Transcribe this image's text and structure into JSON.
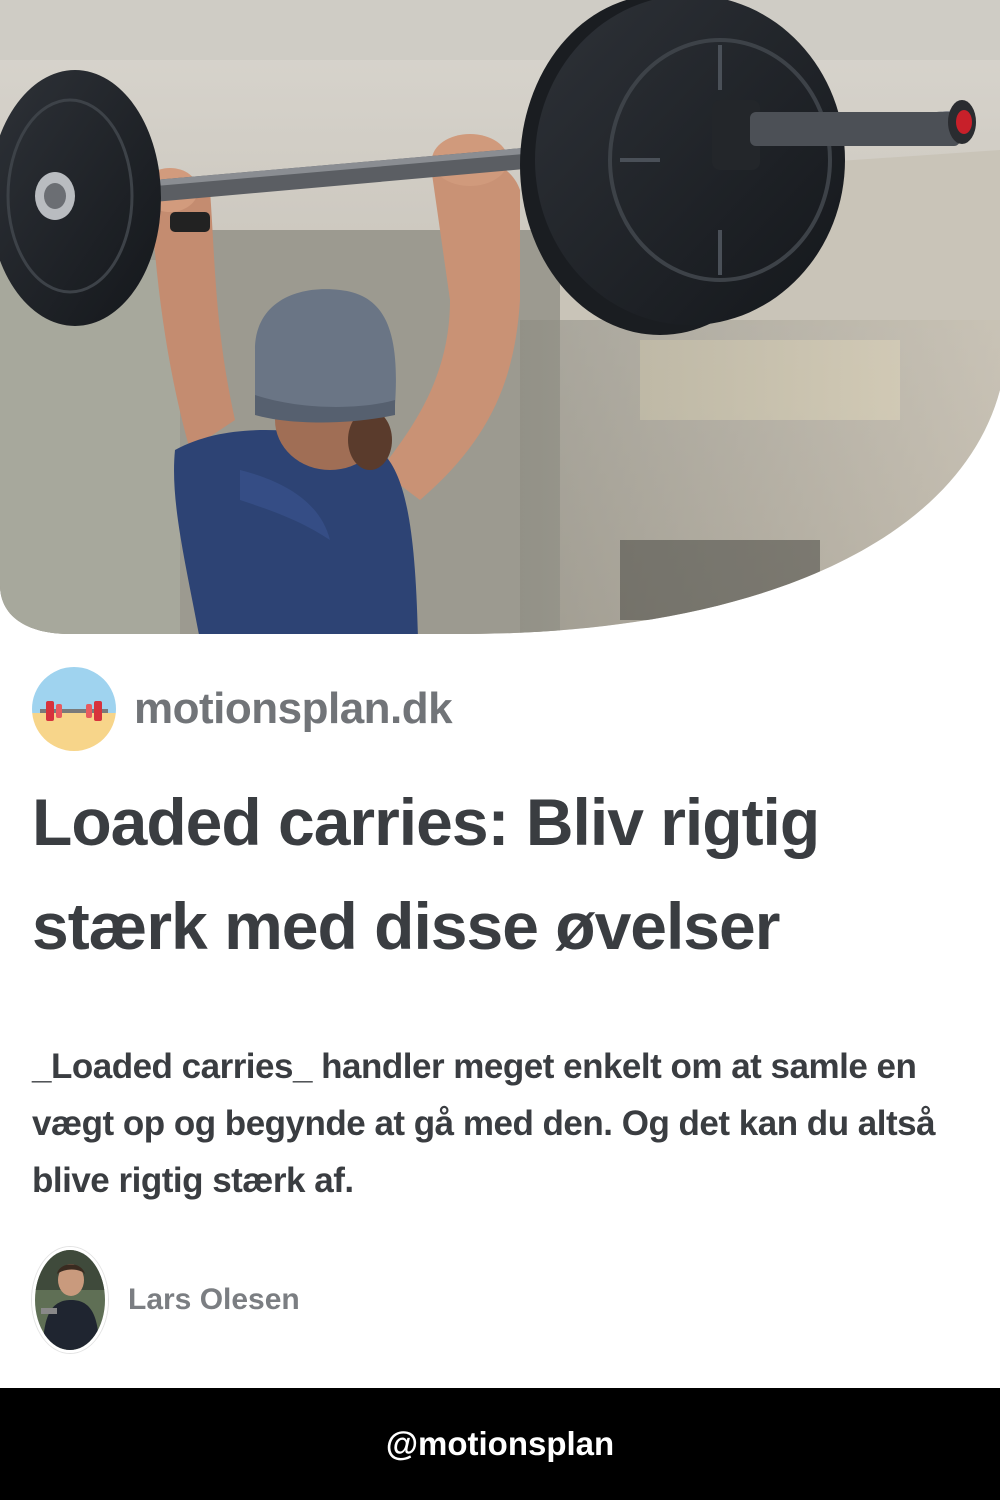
{
  "hero": {
    "image_subject": "man-lifting-barbell-overhead-photo"
  },
  "site": {
    "logo_icon": "barbell-on-beach-logo",
    "name": "motionsplan.dk"
  },
  "article": {
    "title": "Loaded carries: Bliv rigtig stærk med disse øvelser",
    "lede": "_Loaded carries_ handler meget enkelt om at samle en vægt op og begynde at gå med den. Og det kan du altså blive rigtig stærk af."
  },
  "author": {
    "name": "Lars Olesen",
    "avatar_icon": "author-photo"
  },
  "footer": {
    "handle": "@motionsplan"
  },
  "colors": {
    "title_text": "#3a3d41",
    "site_name": "#717478",
    "author_name": "#7b7e82",
    "footer_bg": "#000000",
    "footer_text": "#ffffff"
  }
}
